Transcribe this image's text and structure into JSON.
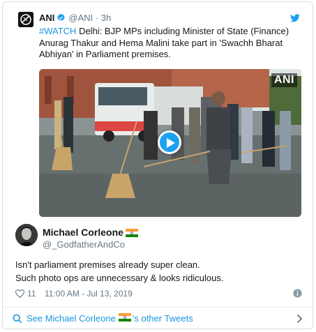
{
  "quoted_tweet": {
    "author_name": "ANI",
    "handle": "@ANI",
    "separator": "·",
    "time": "3h",
    "hashtag": "#WATCH",
    "text": " Delhi: BJP MPs including Minister of State (Finance) Anurag Thakur and Hema Malini take part in 'Swachh Bharat Abhiyan' in Parliament premises.",
    "media_watermark": "ANI"
  },
  "tweet": {
    "author_name": "Michael Corleone",
    "handle": "@_GodfatherAndCo",
    "line1": "Isn't parliament premises already super clean.",
    "line2": "Such photo ops are unnecessary & looks ridiculous.",
    "like_count": "11",
    "timestamp": "11:00 AM - Jul 13, 2019"
  },
  "footer": {
    "prefix": "See Michael Corleone",
    "suffix": "'s other Tweets"
  },
  "colors": {
    "link": "#1b95e0",
    "twitter_blue": "#1da1f2",
    "secondary_text": "#657786"
  },
  "icons": [
    "twitter-bird-icon",
    "verified-badge-icon",
    "play-icon",
    "heart-icon",
    "info-icon",
    "chevron-right-icon",
    "india-flag-icon",
    "search-icon"
  ]
}
